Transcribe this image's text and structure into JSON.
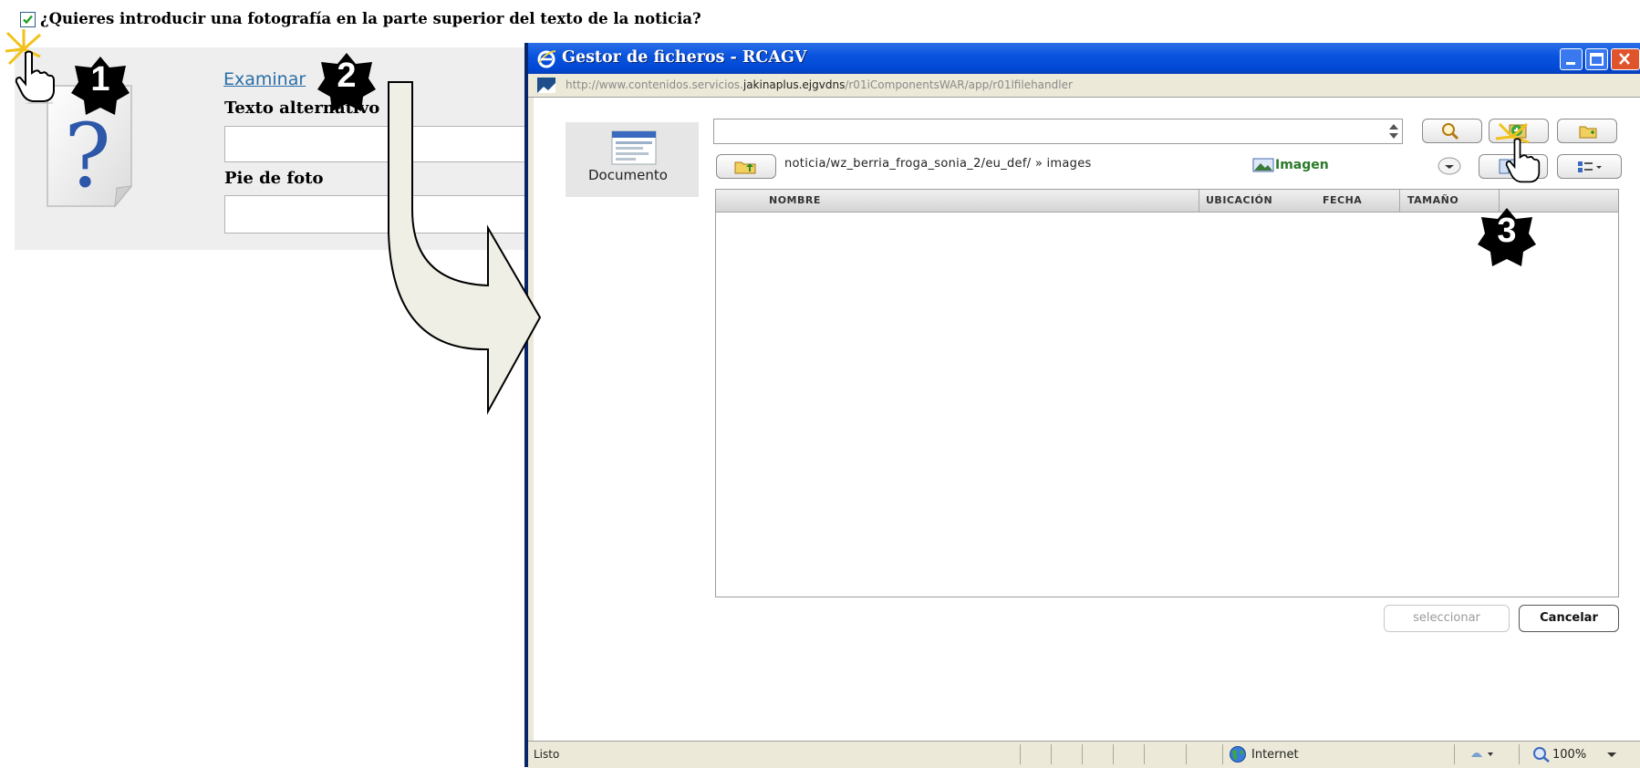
{
  "form": {
    "show_photo_checked": true,
    "show_photo_question": "¿Quieres introducir una fotografía en la parte superior del texto de la noticia?",
    "browse_link": "Examinar",
    "alt_text_label": "Texto alternativo",
    "alt_text_value": "",
    "caption_label": "Pie de foto",
    "caption_value": ""
  },
  "dialog": {
    "title": "Gestor de ficheros - RCAGV",
    "url_prefix": "http://www.contenidos.servicios.",
    "url_host": "jakinaplus.ejgvdns",
    "url_suffix": "/r01iComponentsWAR/app/r01lfilehandler",
    "sidebar_item_label": "Documento",
    "search_value": "",
    "current_path": "noticia/wz_berria_froga_sonia_2/eu_def/ » images",
    "file_type_selected": "Imagen",
    "columns": [
      "NOMBRE",
      "UBICACIÓN",
      "FECHA",
      "TAMAÑO"
    ],
    "files": [],
    "select_button": "seleccionar",
    "cancel_button": "Cancelar",
    "status_text": "Listo",
    "zone_text": "Internet",
    "zoom_text": "100%"
  },
  "annotations": {
    "step_1": "1",
    "step_2": "2",
    "step_3": "3"
  },
  "colors": {
    "titlebar": "#0a55e0",
    "link": "#2a6ea6",
    "panel_bg": "#eeeeee",
    "window_frame": "#ece9d8",
    "annotation_badge": "#000000"
  }
}
